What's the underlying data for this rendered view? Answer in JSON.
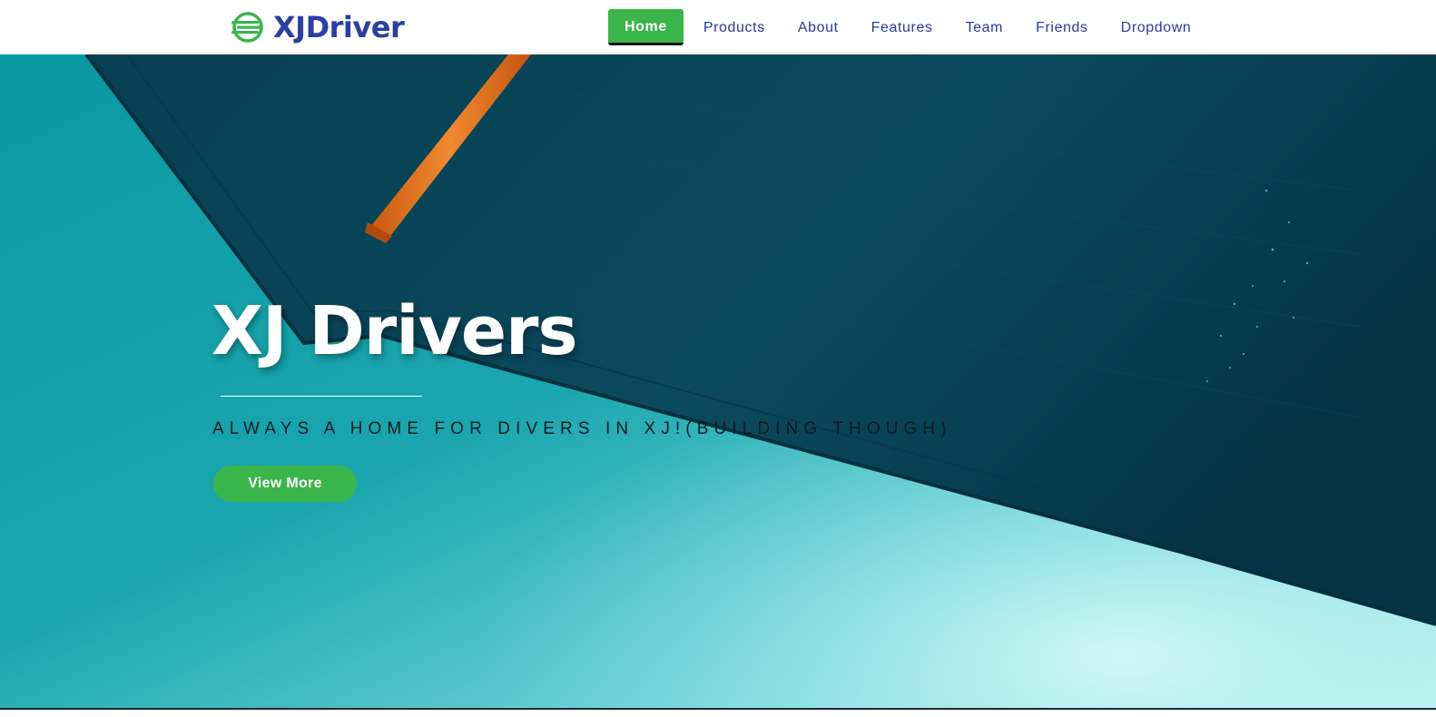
{
  "navbar": {
    "brand": {
      "name": "XJDriver",
      "icon": "striped-circle-logo-icon",
      "color": "#2b3fa3",
      "icon_color": "#39b54a"
    },
    "links": [
      {
        "label": "Home",
        "active": true
      },
      {
        "label": "Products",
        "active": false
      },
      {
        "label": "About",
        "active": false
      },
      {
        "label": "Features",
        "active": false
      },
      {
        "label": "Team",
        "active": false
      },
      {
        "label": "Friends",
        "active": false
      },
      {
        "label": "Dropdown",
        "active": false
      }
    ],
    "accent_color": "#39b54a"
  },
  "hero": {
    "title": "XJ Drivers",
    "subtitle": "ALWAYS A HOME FOR DIVERS IN XJ!(BUILDING THOUGH)",
    "button_label": "View More",
    "background": "teal-umbrella-photo",
    "colors": {
      "dark_teal": "#063f52",
      "light_teal": "#7fdbe0",
      "pole_orange": "#e0741f"
    }
  }
}
